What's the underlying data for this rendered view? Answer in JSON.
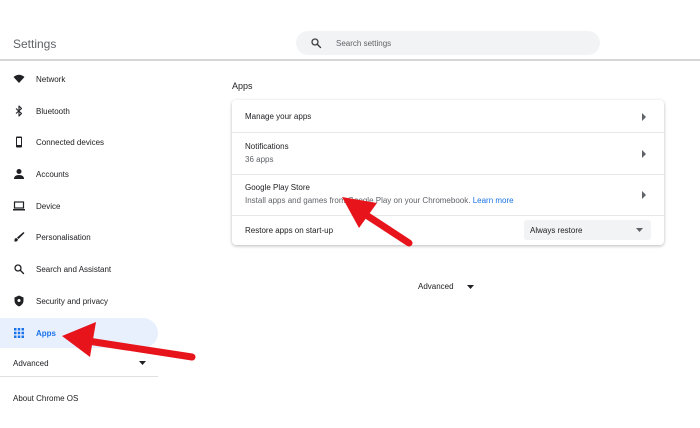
{
  "header": {
    "title": "Settings",
    "search": {
      "placeholder": "Search settings",
      "icon": "search-icon"
    }
  },
  "sidebar": {
    "items": [
      {
        "label": "Network",
        "icon": "wifi-icon"
      },
      {
        "label": "Bluetooth",
        "icon": "bluetooth-icon"
      },
      {
        "label": "Connected devices",
        "icon": "phone-icon"
      },
      {
        "label": "Accounts",
        "icon": "person-icon"
      },
      {
        "label": "Device",
        "icon": "laptop-icon"
      },
      {
        "label": "Personalisation",
        "icon": "brush-icon"
      },
      {
        "label": "Search and Assistant",
        "icon": "search-icon"
      },
      {
        "label": "Security and privacy",
        "icon": "shield-icon"
      },
      {
        "label": "Apps",
        "icon": "apps-grid-icon",
        "active": true
      }
    ],
    "advanced_label": "Advanced",
    "about_label": "About Chrome OS"
  },
  "main": {
    "section_title": "Apps",
    "rows": [
      {
        "title": "Manage your apps"
      },
      {
        "title": "Notifications",
        "subtitle": "36 apps"
      },
      {
        "title": "Google Play Store",
        "subtitle": "Install apps and games from Google Play on your Chromebook.",
        "link": "Learn more"
      },
      {
        "title": "Restore apps on start-up",
        "select_value": "Always restore"
      }
    ],
    "advanced_label": "Advanced"
  },
  "colors": {
    "accent": "#1a73e8",
    "active_bg": "#e8f0fe",
    "annotation_arrow": "#e8141b"
  }
}
